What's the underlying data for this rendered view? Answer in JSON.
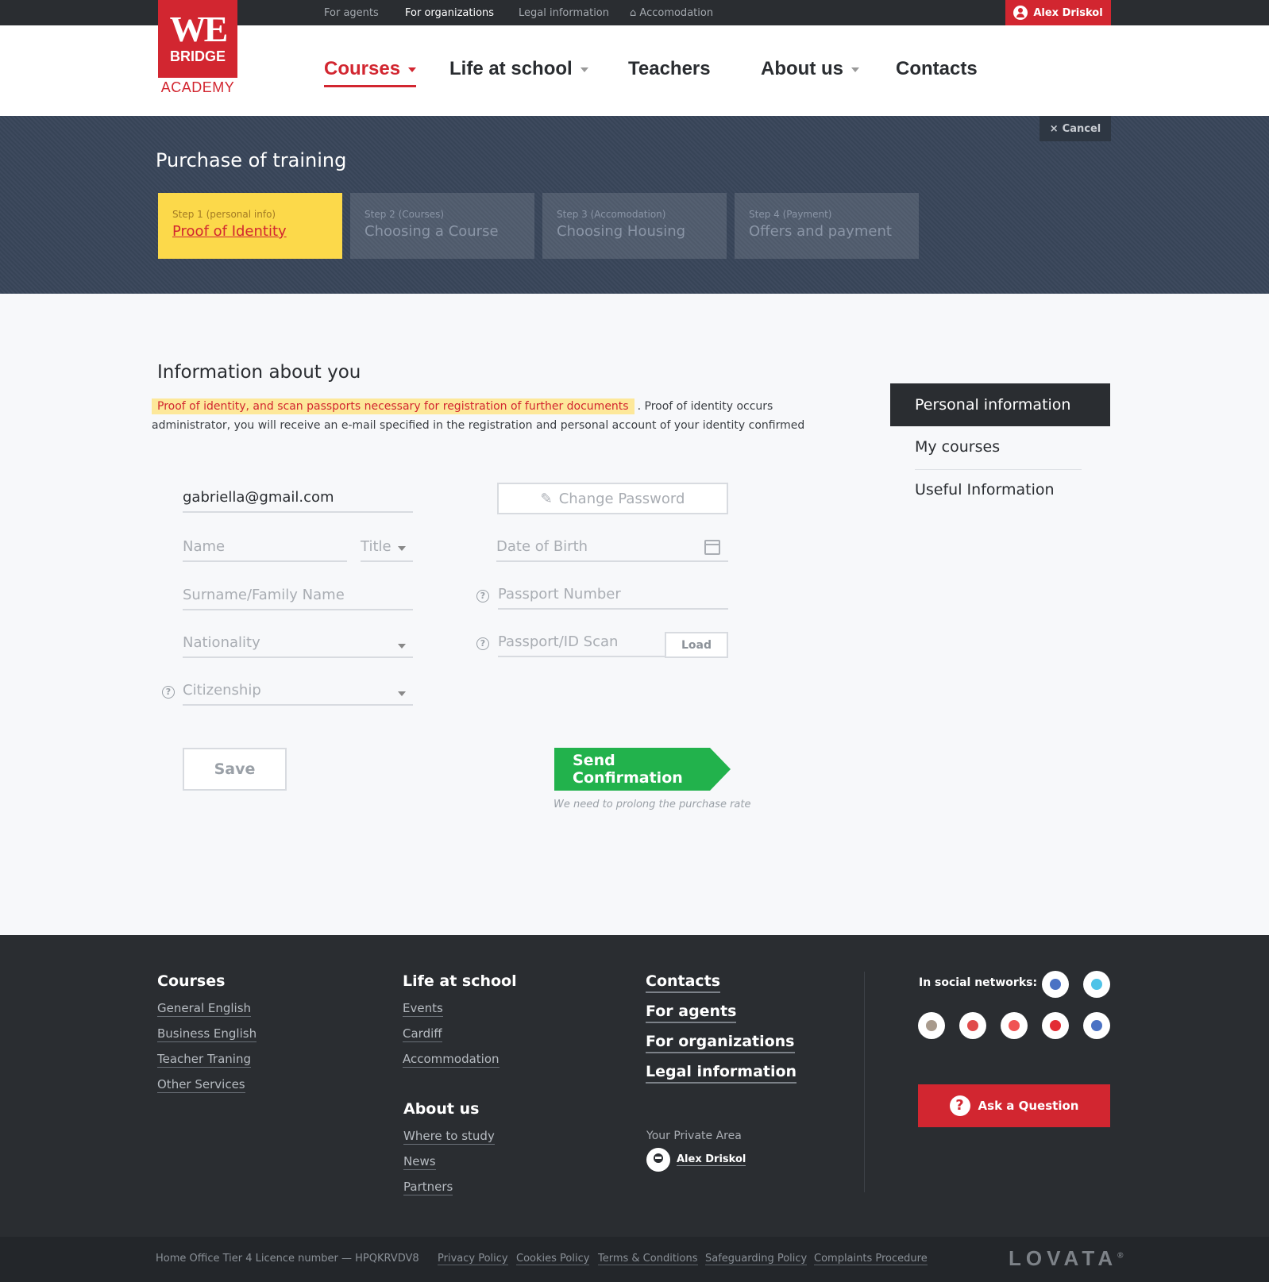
{
  "topbar": {
    "links": [
      "For agents",
      "For organizations",
      "Legal information",
      "Accomodation"
    ],
    "user": "Alex Driskol"
  },
  "logo": {
    "line1": "WE",
    "line2": "BRIDGE",
    "line3": "ACADEMY"
  },
  "nav": {
    "courses": "Courses",
    "life": "Life at school",
    "teachers": "Teachers",
    "about": "About us",
    "contacts": "Contacts"
  },
  "hero": {
    "cancel": "Cancel",
    "title": "Purchase of training",
    "steps": [
      {
        "label": "Step 1 (personal info)",
        "title": "Proof of Identity"
      },
      {
        "label": "Step 2 (Courses)",
        "title": "Choosing a Course"
      },
      {
        "label": "Step 3 (Accomodation)",
        "title": "Choosing Housing"
      },
      {
        "label": "Step 4 (Payment)",
        "title": "Offers and payment"
      }
    ]
  },
  "info": {
    "title": "Information about you",
    "highlight": "Proof of identity, and scan passports necessary for registration of further documents",
    "text": ". Proof of identity occurs administrator, you will receive an e-mail specified in the registration and personal account of your identity confirmed"
  },
  "form": {
    "email": "gabriella@gmail.com",
    "change_password": "Change Password",
    "name": "Name",
    "title": "Title",
    "dob": "Date of Birth",
    "surname": "Surname/Family Name",
    "passport_number": "Passport Number",
    "nationality": "Nationality",
    "passport_scan": "Passport/ID Scan",
    "load": "Load",
    "citizenship": "Citizenship",
    "help": "?",
    "save": "Save",
    "send": "Send Confirmation",
    "send_note": "We need to prolong the purchase rate"
  },
  "side": {
    "items": [
      "Personal information",
      "My courses",
      "Useful Information"
    ]
  },
  "footer": {
    "courses": {
      "title": "Courses",
      "links": [
        "General English",
        "Business English",
        "Teacher Traning",
        "Other Services"
      ]
    },
    "life": {
      "title": "Life at school",
      "links": [
        "Events",
        "Cardiff",
        "Accommodation"
      ]
    },
    "about": {
      "title": "About us",
      "links": [
        "Where to study",
        "News",
        "Partners"
      ]
    },
    "main_links": [
      "Contacts",
      "For agents",
      "For organizations",
      "Legal information"
    ],
    "private_label": "Your Private Area",
    "private_user": "Alex Driskol",
    "social_label": "In social networks:",
    "ask": "Ask a Question"
  },
  "social_colors": [
    "#4a72c4",
    "#4fc3e8",
    "#a89a8c",
    "#e04b4b",
    "#f05454",
    "#e32c34",
    "#4a72c4"
  ],
  "bottom": {
    "licence": "Home Office Tier 4 Licence number — HPQKRVDV8",
    "links": [
      "Privacy Policy",
      "Cookies Policy",
      "Terms & Conditions",
      "Safeguarding Policy",
      "Complaints Procedure"
    ],
    "brand": "LOVATA",
    "brand_mark": "®"
  },
  "colors": {
    "brand_red": "#d22630",
    "step_active": "#fcd94a",
    "send_green": "#22b24c",
    "dark": "#2a2d31"
  }
}
